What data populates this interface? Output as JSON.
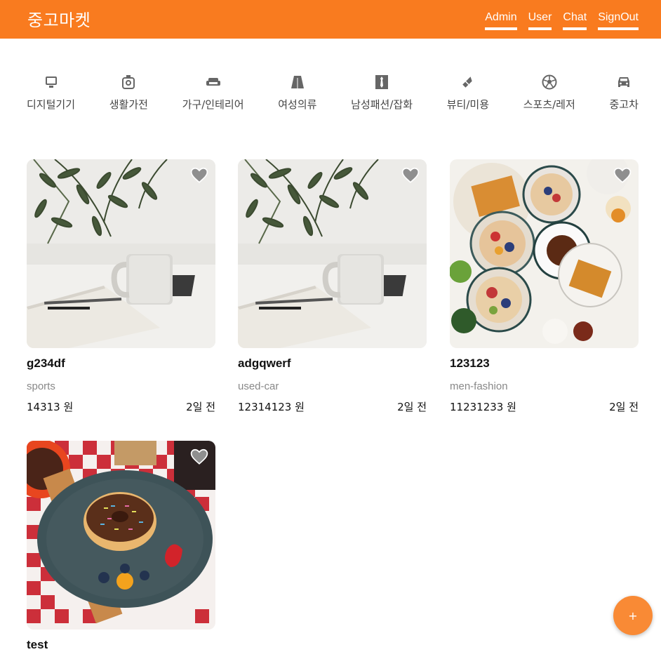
{
  "header": {
    "brand": "중고마켓",
    "nav": [
      "Admin",
      "User",
      "Chat",
      "SignOut"
    ]
  },
  "categories": [
    {
      "label": "디지털기기",
      "icon": "monitor-icon"
    },
    {
      "label": "생활가전",
      "icon": "rice-cooker-icon"
    },
    {
      "label": "가구/인테리어",
      "icon": "sofa-icon"
    },
    {
      "label": "여성의류",
      "icon": "skirt-icon"
    },
    {
      "label": "남성패션/잡화",
      "icon": "necktie-icon"
    },
    {
      "label": "뷰티/미용",
      "icon": "lipstick-icon"
    },
    {
      "label": "스포츠/레저",
      "icon": "soccer-ball-icon"
    },
    {
      "label": "중고차",
      "icon": "car-icon"
    }
  ],
  "products": [
    {
      "title": "g234df",
      "category": "sports",
      "price": "14313 원",
      "time": "2일 전",
      "image": "desk-mug-photo"
    },
    {
      "title": "adgqwerf",
      "category": "used-car",
      "price": "12314123 원",
      "time": "2일 전",
      "image": "desk-mug-photo"
    },
    {
      "title": "123123",
      "category": "men-fashion",
      "price": "11231233 원",
      "time": "2일 전",
      "image": "breakfast-table-photo"
    },
    {
      "title": "test",
      "category": "",
      "price": "",
      "time": "",
      "image": "donut-plate-photo"
    }
  ],
  "fab": {
    "label": "+"
  },
  "colors": {
    "header": "#f97b1f",
    "fab": "#f98a35"
  }
}
